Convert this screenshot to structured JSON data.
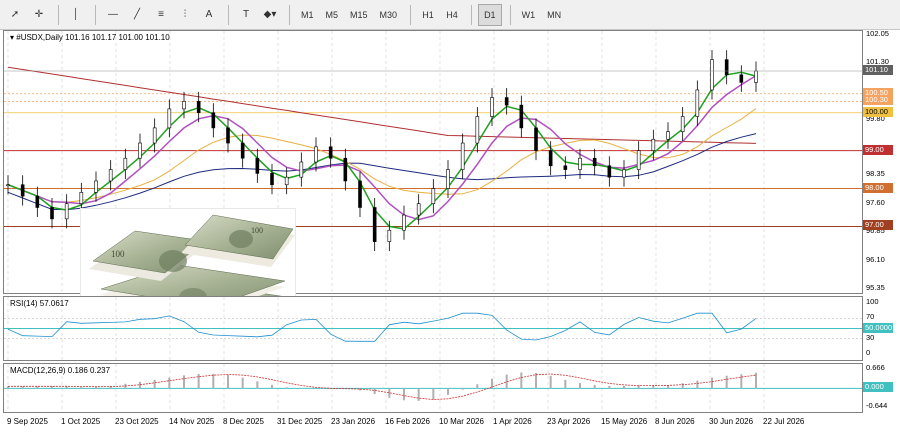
{
  "toolbar": {
    "tools": [
      {
        "name": "cursor-tool",
        "glyph": "➚"
      },
      {
        "name": "crosshair-tool",
        "glyph": "✛"
      },
      {
        "name": "vertical-line-tool",
        "glyph": "│"
      },
      {
        "name": "horizontal-line-tool",
        "glyph": "—"
      },
      {
        "name": "trendline-tool",
        "glyph": "╱"
      },
      {
        "name": "equidistant-channel-tool",
        "glyph": "≡"
      },
      {
        "name": "fibonacci-tool",
        "glyph": "⫶"
      },
      {
        "name": "text-tool",
        "glyph": "A"
      },
      {
        "name": "text-label-tool",
        "glyph": "T"
      },
      {
        "name": "shapes-tool",
        "glyph": "◆▾"
      }
    ],
    "timeframes": [
      "M1",
      "M5",
      "M15",
      "M30",
      "H1",
      "H4",
      "D1",
      "W1",
      "MN"
    ],
    "active_timeframe": "D1"
  },
  "main": {
    "title": "▾ #USDX,Daily  101.16 101.17 101.00 101.10",
    "price_ticks": [
      "102.05",
      "101.30",
      "99.80",
      "98.35",
      "97.60",
      "96.85",
      "96.10",
      "95.35"
    ],
    "badges": [
      {
        "label": "101.10",
        "color": "#606060",
        "text": "#ffffff"
      },
      {
        "label": "100.50",
        "color": "#f4a460",
        "text": "#ffffff"
      },
      {
        "label": "100.30",
        "color": "#f4a460",
        "text": "#ffffff"
      },
      {
        "label": "100.00",
        "color": "#f0c040",
        "text": "#000000"
      },
      {
        "label": "99.00",
        "color": "#c03030",
        "text": "#ffffff"
      },
      {
        "label": "98.00",
        "color": "#d07030",
        "text": "#ffffff"
      },
      {
        "label": "97.00",
        "color": "#a04020",
        "text": "#ffffff"
      }
    ]
  },
  "rsi": {
    "title": "RSI(14) 57.0617",
    "ticks": [
      "100",
      "70",
      "30",
      "0"
    ],
    "badge": "50.0000"
  },
  "macd": {
    "title": "MACD(12,26,9) 0.186 0.237",
    "ticks": [
      "0.666",
      "-0.644"
    ],
    "badge": "0.000"
  },
  "xaxis": {
    "dates": [
      "9 Sep 2025",
      "1 Oct 2025",
      "23 Oct 2025",
      "14 Nov 2025",
      "8 Dec 2025",
      "31 Dec 2025",
      "23 Jan 2026",
      "16 Feb 2026",
      "10 Mar 2026",
      "1 Apr 2026",
      "23 Apr 2026",
      "15 May 2026",
      "8 Jun 2026",
      "30 Jun 2026",
      "22 Jul 2026"
    ]
  },
  "chart_data": {
    "type": "line",
    "symbol": "#USDX",
    "timeframe": "Daily",
    "ylim": [
      95.35,
      102.05
    ],
    "close": [
      98.1,
      97.8,
      97.5,
      97.2,
      97.6,
      97.9,
      98.2,
      98.5,
      98.8,
      99.2,
      99.6,
      100.1,
      100.3,
      100.0,
      99.6,
      99.2,
      98.8,
      98.4,
      98.1,
      98.3,
      98.7,
      99.1,
      98.8,
      98.2,
      97.5,
      96.6,
      96.9,
      97.3,
      97.6,
      98.0,
      98.5,
      99.2,
      99.9,
      100.4,
      100.2,
      99.6,
      99.0,
      98.6,
      98.5,
      98.8,
      98.6,
      98.3,
      98.5,
      99.0,
      99.3,
      99.5,
      99.9,
      100.6,
      101.4,
      101.0,
      100.8,
      101.1
    ],
    "levels": [
      100.5,
      100.3,
      100.0,
      99.0,
      98.0,
      97.0
    ],
    "rsi": {
      "value": 57.0617,
      "levels": [
        70,
        50,
        30
      ]
    },
    "macd": {
      "main": 0.186,
      "signal": 0.237,
      "ylim": [
        -0.644,
        0.666
      ]
    }
  }
}
